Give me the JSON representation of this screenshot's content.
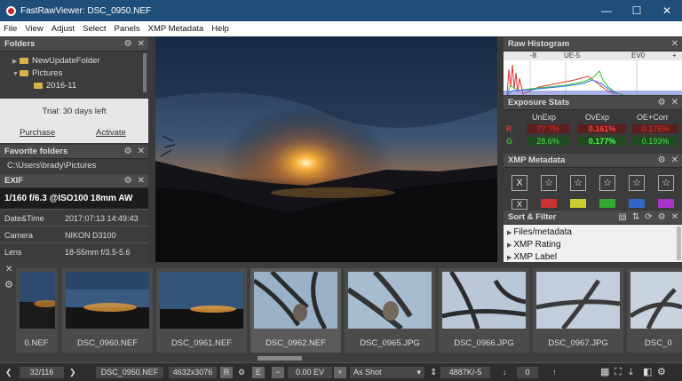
{
  "window": {
    "title": "FastRawViewer: DSC_0950.NEF",
    "minimize": "—",
    "maximize": "☐",
    "close": "✕"
  },
  "menu": [
    "File",
    "View",
    "Adjust",
    "Select",
    "Panels",
    "XMP Metadata",
    "Help"
  ],
  "folders": {
    "title": "Folders",
    "items": [
      "NewUpdateFolder",
      "Pictures",
      "2016-11"
    ]
  },
  "trial": {
    "text": "Trial: 30 days left",
    "purchase": "Purchase",
    "activate": "Activate"
  },
  "favorites": {
    "title": "Favorite folders",
    "path": "C:\\Users\\brady\\Pictures"
  },
  "exif": {
    "title": "EXIF",
    "summary": "1/160 f/6.3 @ISO100 18mm AW",
    "rows": [
      {
        "key": "Date&Time",
        "value": "2017:07:13 14:49:43"
      },
      {
        "key": "Camera",
        "value": "NIKON D3100"
      },
      {
        "key": "Lens",
        "value": "18-55mm f/3.5-5.6"
      }
    ]
  },
  "histogram": {
    "title": "Raw Histogram",
    "ticks": [
      "-8",
      "UE-5",
      "EV0",
      "+"
    ],
    "colors": {
      "red": "#e53030",
      "green": "#30c030",
      "blue": "#3070ff"
    }
  },
  "exposure": {
    "title": "Exposure Stats",
    "headers": [
      "UnExp",
      "OvExp",
      "OE+Corr"
    ],
    "rows": [
      {
        "channel": "R",
        "unexp": "??.?%",
        "ovexp": "0.161%",
        "oecorr": "0.176%"
      },
      {
        "channel": "G",
        "unexp": "28.6%",
        "ovexp": "0.177%",
        "oecorr": "0.193%"
      }
    ]
  },
  "xmp": {
    "title": "XMP Metadata",
    "reject": "X",
    "star": "☆",
    "color_x": "X"
  },
  "sort_filter": {
    "title": "Sort & Filter",
    "items": [
      "Files/metadata",
      "XMP Rating",
      "XMP Label"
    ]
  },
  "thumbnails": [
    {
      "label": "0.NEF"
    },
    {
      "label": "DSC_0960.NEF"
    },
    {
      "label": "DSC_0961.NEF"
    },
    {
      "label": "DSC_0962.NEF"
    },
    {
      "label": "DSC_0965.JPG"
    },
    {
      "label": "DSC_0966.JPG"
    },
    {
      "label": "DSC_0967.JPG"
    },
    {
      "label": "DSC_0"
    }
  ],
  "status": {
    "counter": "32/116",
    "filename": "DSC_0950.NEF",
    "dimensions": "4632x3076",
    "raw_flag": "R",
    "e_flag": "E",
    "ev": "0.00 EV",
    "wb": "As Shot",
    "temp": "4887K/-5",
    "rating": "0"
  }
}
